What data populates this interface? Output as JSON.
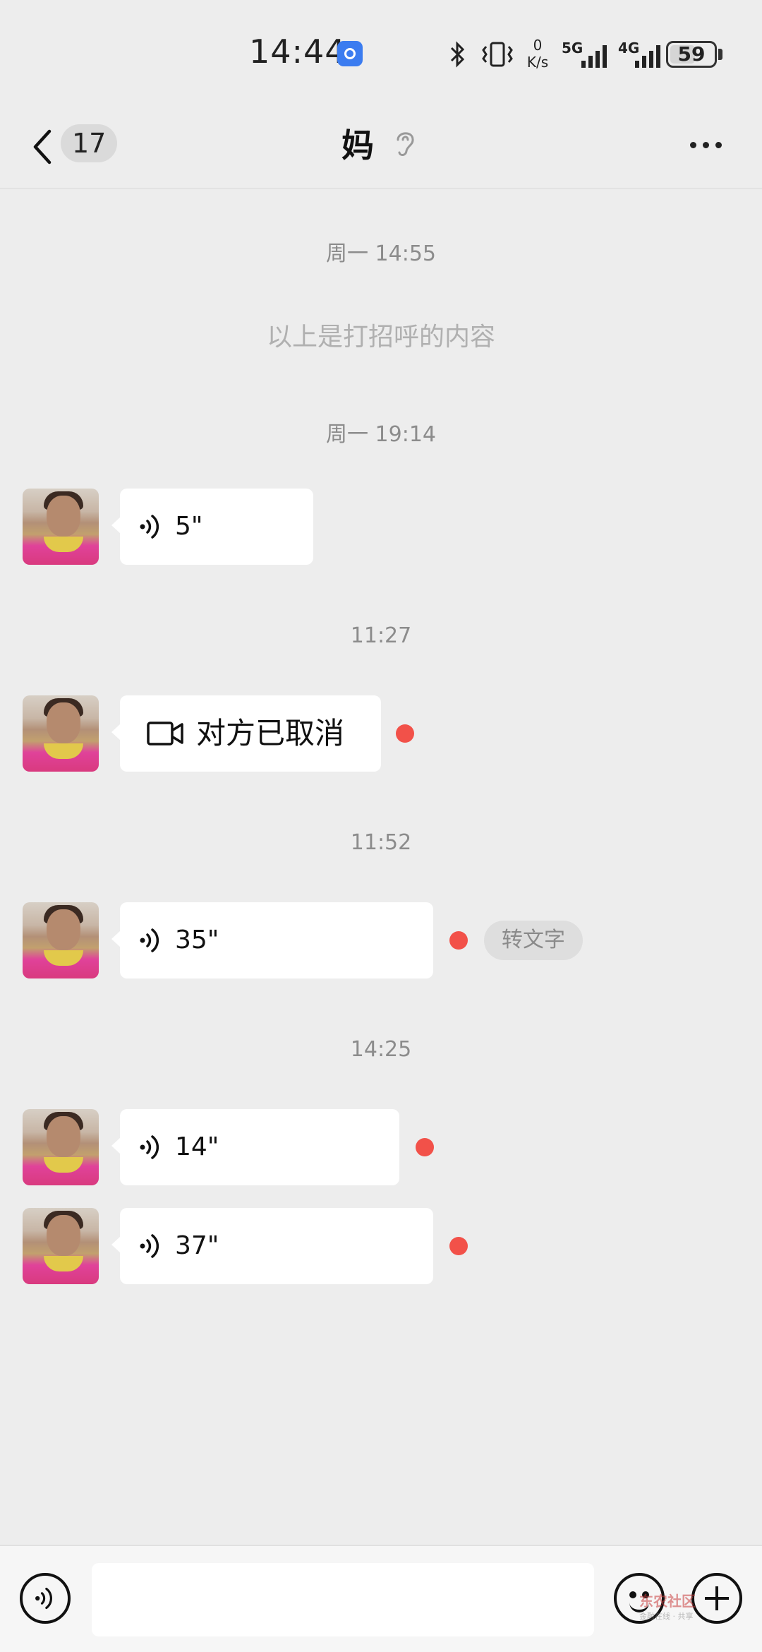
{
  "status_bar": {
    "time": "14:44",
    "net_speed_value": "0",
    "net_speed_unit": "K/s",
    "network_1": "5G",
    "network_2": "4G",
    "battery": "59",
    "battery_percent": 59
  },
  "header": {
    "unread_count": "17",
    "title": "妈"
  },
  "messages": [
    {
      "type": "time",
      "text": "周一 14:55"
    },
    {
      "type": "system",
      "text": "以上是打招呼的内容"
    },
    {
      "type": "time",
      "text": "周一 19:14"
    },
    {
      "type": "voice",
      "duration": "5\"",
      "unread": false
    },
    {
      "type": "time",
      "text": "11:27"
    },
    {
      "type": "video_call",
      "text": "对方已取消",
      "unread": true
    },
    {
      "type": "time",
      "text": "11:52"
    },
    {
      "type": "voice",
      "duration": "35\"",
      "unread": true,
      "action_label": "转文字"
    },
    {
      "type": "time",
      "text": "14:25"
    },
    {
      "type": "voice",
      "duration": "14\"",
      "unread": true
    },
    {
      "type": "voice",
      "duration": "37\"",
      "unread": true
    }
  ],
  "input_bar": {
    "placeholder": ""
  },
  "watermark": {
    "title": "东农社区",
    "subtitle": "金融在线 · 共享"
  },
  "colors": {
    "background": "#ededed",
    "bubble": "#ffffff",
    "unread_dot": "#f25149",
    "time_text": "#8c8c8c"
  }
}
